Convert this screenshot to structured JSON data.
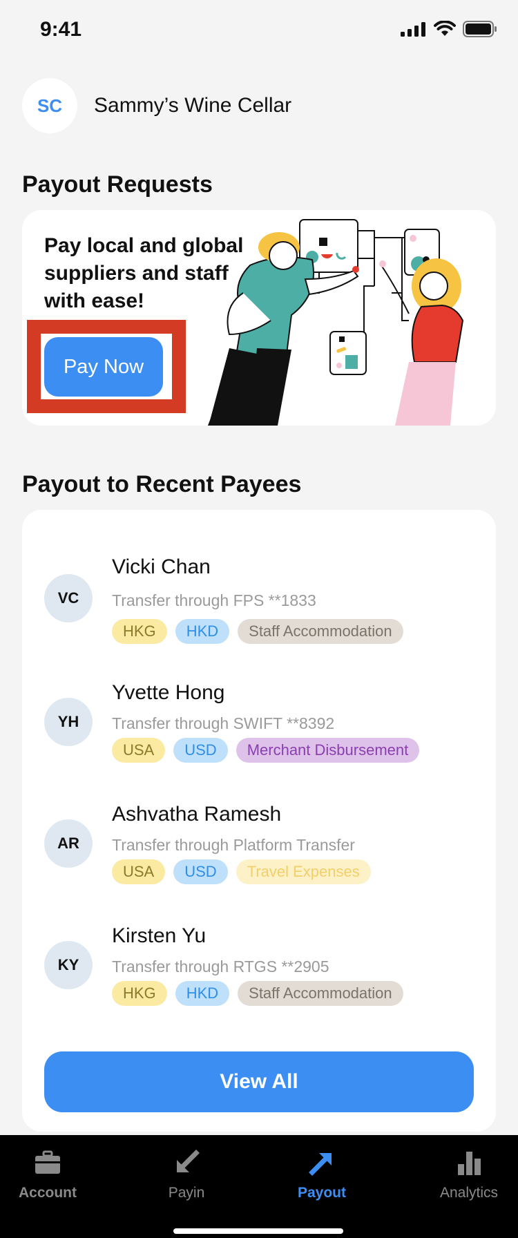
{
  "status_bar": {
    "time": "9:41"
  },
  "header": {
    "avatar_initials": "SC",
    "business_name": "Sammy’s Wine Cellar"
  },
  "payout_requests": {
    "title": "Payout Requests",
    "promo_text": "Pay local and global suppliers and staff with ease!",
    "button_label": "Pay Now"
  },
  "recent_payees": {
    "title": "Payout to Recent Payees",
    "payees": [
      {
        "initials": "VC",
        "name": "Vicki Chan",
        "method": "Transfer through FPS **1833",
        "country": "HKG",
        "currency": "HKD",
        "category": "Staff Accommodation"
      },
      {
        "initials": "YH",
        "name": "Yvette Hong",
        "method": "Transfer through SWIFT **8392",
        "country": "USA",
        "currency": "USD",
        "category": "Merchant Disbursement"
      },
      {
        "initials": "AR",
        "name": "Ashvatha Ramesh",
        "method": "Transfer through Platform Transfer",
        "country": "USA",
        "currency": "USD",
        "category": "Travel Expenses"
      },
      {
        "initials": "KY",
        "name": "Kirsten Yu",
        "method": "Transfer through RTGS **2905",
        "country": "HKG",
        "currency": "HKD",
        "category": "Staff Accommodation"
      }
    ],
    "view_all_label": "View All"
  },
  "tab_bar": {
    "active": "Payout",
    "tabs": [
      {
        "label": "Account",
        "icon": "briefcase-icon"
      },
      {
        "label": "Payin",
        "icon": "arrow-down-left-icon"
      },
      {
        "label": "Payout",
        "icon": "arrow-up-right-icon"
      },
      {
        "label": "Analytics",
        "icon": "bar-chart-icon"
      }
    ]
  },
  "colors": {
    "accent": "#3d8ef2",
    "highlight": "#d33b24",
    "tag_country_bg": "#fbeaa2",
    "tag_currency_bg": "#bfe0fb",
    "tag_staff_bg": "#e2dcd5",
    "tag_merchant_bg": "#dec2ea",
    "tag_travel_bg": "#fdf1c8"
  }
}
